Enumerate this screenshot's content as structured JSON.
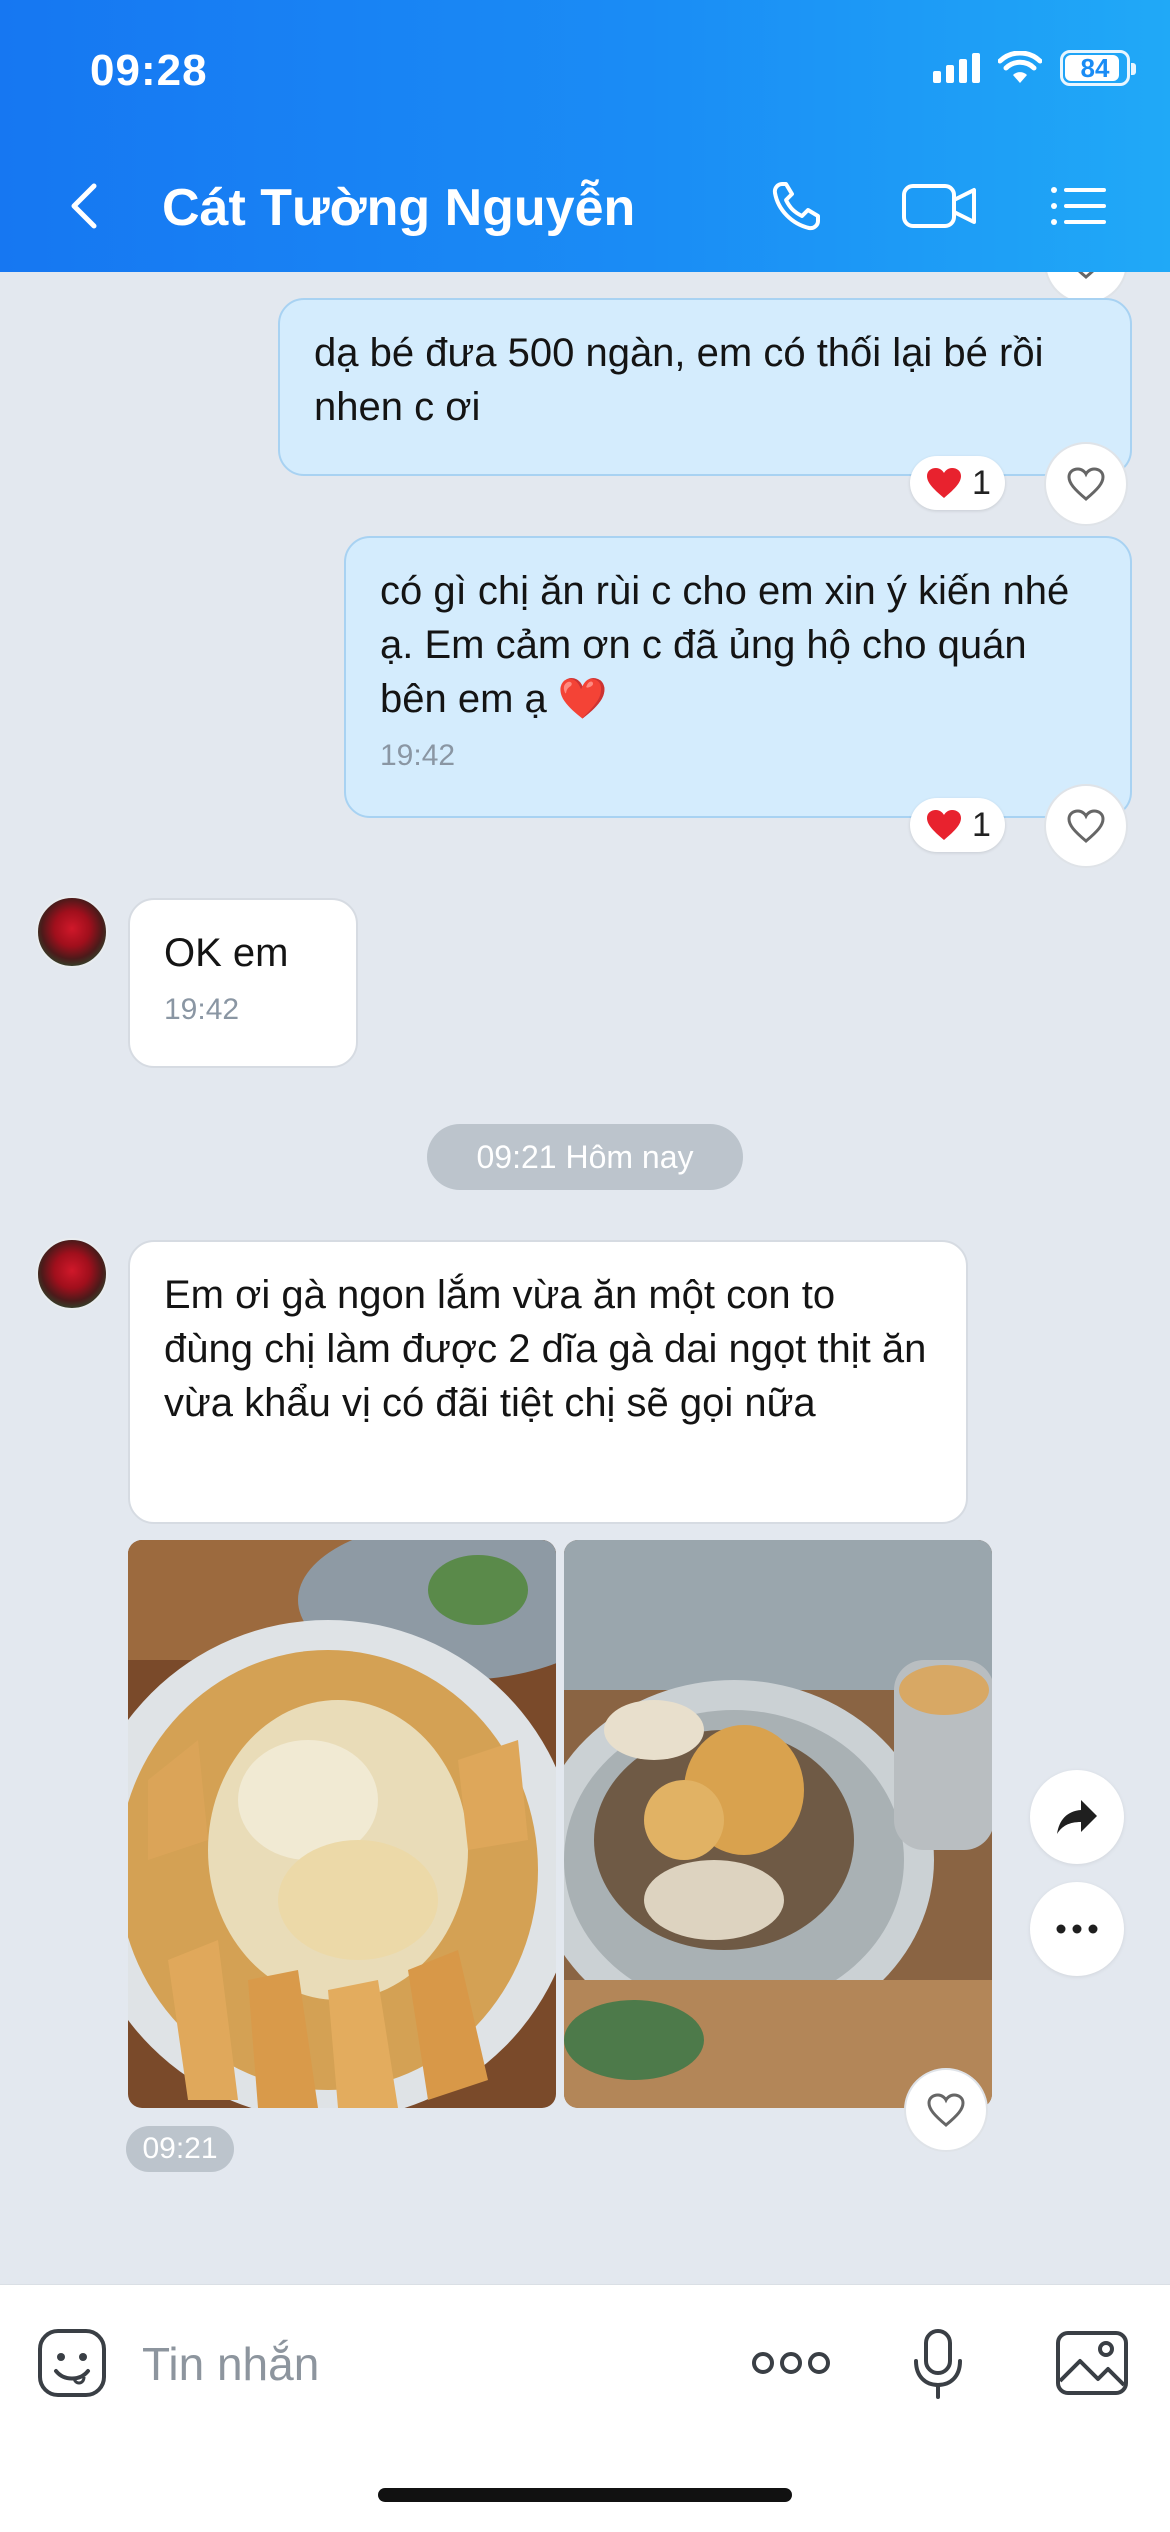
{
  "status_bar": {
    "time": "09:28",
    "battery": "84"
  },
  "header": {
    "contact_name": "Cát Tường Nguyễn"
  },
  "messages": {
    "m1": {
      "text": "dạ bé đưa 500 ngàn, em có thối lại bé rồi nhen c ơi",
      "reaction_count": "1"
    },
    "m2": {
      "text": "có gì chị ăn rùi c cho em xin ý kiến nhé ạ. Em cảm ơn c đã ủng hộ cho quán bên em ạ ❤️",
      "time": "19:42",
      "reaction_count": "1"
    },
    "m3": {
      "text": "OK em",
      "time": "19:42"
    },
    "date_separator": "09:21 Hôm nay",
    "m4": {
      "text": "Em ơi gà ngon lắm vừa ăn một con to đùng chị làm được 2 dĩa gà dai ngọt thịt ăn vừa khẩu vị có đãi tiệt chị sẽ gọi nữa"
    },
    "images_time": "09:21"
  },
  "input": {
    "placeholder": "Tin nhắn"
  },
  "colors": {
    "header_start": "#1677f2",
    "header_end": "#20a9f7",
    "outgoing_bubble": "#d4ecfd",
    "incoming_bubble": "#ffffff",
    "heart": "#e8222e"
  },
  "icons": [
    "back-icon",
    "phone-icon",
    "video-call-icon",
    "menu-list-icon",
    "heart-icon",
    "share-icon",
    "more-icon",
    "sticker-icon",
    "more-dots-icon",
    "microphone-icon",
    "image-icon"
  ]
}
